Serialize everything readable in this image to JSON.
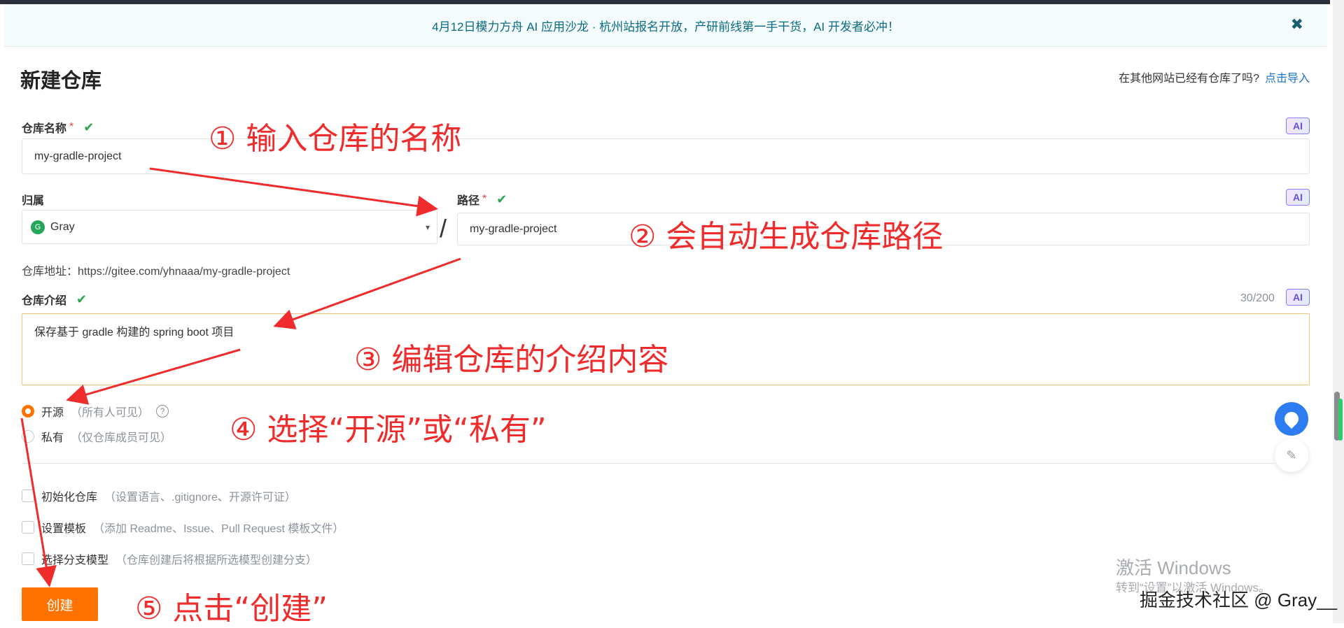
{
  "banner": {
    "text": "4月12日模力方舟 AI 应用沙龙 · 杭州站报名开放，产研前线第一手干货，AI 开发者必冲！",
    "close": "✖"
  },
  "header": {
    "title": "新建仓库",
    "import_prompt": "在其他网站已经有仓库了吗?",
    "import_link": "点击导入"
  },
  "form": {
    "name_label": "仓库名称",
    "required": "*",
    "check": "✔",
    "ai": "AI",
    "name_value": "my-gradle-project",
    "owner_label": "归属",
    "owner_avatar": "G",
    "owner_value": "Gray",
    "owner_caret": "▾",
    "slash": "/",
    "path_label": "路径",
    "path_value": "my-gradle-project",
    "address_label": "仓库地址：",
    "address_value": "https://gitee.com/yhnaaa/my-gradle-project",
    "desc_label": "仓库介绍",
    "desc_count": "30/200",
    "desc_value": "保存基于 gradle 构建的 spring boot 项目",
    "visibility": [
      {
        "label": "开源",
        "hint": "（所有人可见）",
        "selected": true
      },
      {
        "label": "私有",
        "hint": "（仅仓库成员可见）",
        "selected": false
      }
    ],
    "help": "?",
    "options": [
      {
        "label": "初始化仓库",
        "hint": "（设置语言、.gitignore、开源许可证）"
      },
      {
        "label": "设置模板",
        "hint": "（添加 Readme、Issue、Pull Request 模板文件）"
      },
      {
        "label": "选择分支模型",
        "hint": "（仓库创建后将根据所选模型创建分支）"
      }
    ],
    "submit": "创建"
  },
  "annotations": [
    "① 输入仓库的名称",
    "② 会自动生成仓库路径",
    "③ 编辑仓库的介绍内容",
    "④ 选择“开源”或“私有”",
    "⑤ 点击“创建”"
  ],
  "watermark": {
    "line1": "激活 Windows",
    "line2": "转到“设置”以激活 Windows。",
    "credit": "掘金技术社区 @ Gray__"
  },
  "colors": {
    "accent": "#fe7300",
    "annotation": "#ef2b2b",
    "link": "#1a73c8"
  }
}
